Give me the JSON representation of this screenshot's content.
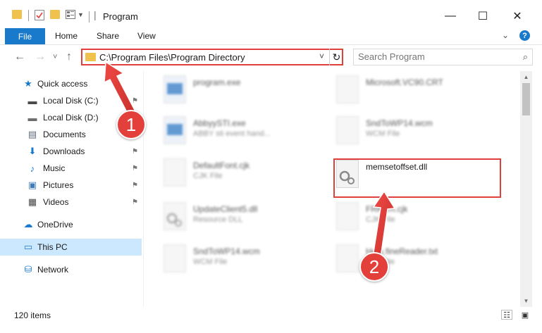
{
  "window": {
    "title": "Program",
    "controls": {
      "minimize": "—",
      "maximize": "☐",
      "close": "✕"
    }
  },
  "ribbon": {
    "tabs": [
      "File",
      "Home",
      "Share",
      "View"
    ],
    "collapse_icon": "chevron-down-icon",
    "help": "?"
  },
  "navigation": {
    "back": "←",
    "forward": "→",
    "recent": "˅",
    "up": "↑",
    "address": "C:\\Program Files\\Program Directory",
    "address_dropdown": "˅",
    "refresh": "↻",
    "search_placeholder": "Search Program",
    "search_icon": "⌕"
  },
  "sidebar": {
    "items": [
      {
        "label": "Quick access",
        "icon": "star-icon",
        "glyph": "★",
        "color": "#1979ca",
        "pinned": false
      },
      {
        "label": "Local Disk (C:)",
        "icon": "drive-icon",
        "glyph": "▬",
        "color": "#4a4a4a",
        "pinned": true
      },
      {
        "label": "Local Disk (D:)",
        "icon": "drive-icon",
        "glyph": "▬",
        "color": "#6d6d6d",
        "pinned": true
      },
      {
        "label": "Documents",
        "icon": "documents-icon",
        "glyph": "▤",
        "color": "#5a6a7a",
        "pinned": true
      },
      {
        "label": "Downloads",
        "icon": "downloads-icon",
        "glyph": "⬇",
        "color": "#1979ca",
        "pinned": true
      },
      {
        "label": "Music",
        "icon": "music-icon",
        "glyph": "♪",
        "color": "#1979ca",
        "pinned": true
      },
      {
        "label": "Pictures",
        "icon": "pictures-icon",
        "glyph": "▣",
        "color": "#3f7cb8",
        "pinned": true
      },
      {
        "label": "Videos",
        "icon": "videos-icon",
        "glyph": "▦",
        "color": "#444444",
        "pinned": true
      },
      {
        "label": "OneDrive",
        "icon": "cloud-icon",
        "glyph": "☁",
        "color": "#1979ca",
        "pinned": false
      },
      {
        "label": "This PC",
        "icon": "computer-icon",
        "glyph": "▭",
        "color": "#1979ca",
        "pinned": false
      },
      {
        "label": "Network",
        "icon": "network-icon",
        "glyph": "⛁",
        "color": "#1979ca",
        "pinned": false
      }
    ],
    "pin_glyph": "📌"
  },
  "files": [
    {
      "name": "program.exe",
      "type": "",
      "blurred": true
    },
    {
      "name": "Microsoft.VC90.CRT",
      "type": "",
      "blurred": true
    },
    {
      "name": "AbbyySTI.exe",
      "type": "ABBY sti event hand...",
      "blurred": true
    },
    {
      "name": "SndToWP14.wcm",
      "type": "WCM File",
      "blurred": true
    },
    {
      "name": "DefaultFont.cjk",
      "type": "CJK File",
      "blurred": true
    },
    {
      "name": "memsetoffset.dll",
      "type": "",
      "blurred": false
    },
    {
      "name": "UpdateClient5.dll",
      "type": "Resource DLL",
      "blurred": true
    },
    {
      "name": "FRKorn.cjk",
      "type": "CJK File",
      "blurred": true
    },
    {
      "name": "SndToWP14.wcm",
      "type": "WCM File",
      "blurred": true
    },
    {
      "name": "Help.fineReader.txt",
      "type": "Text File",
      "blurred": true
    }
  ],
  "status": {
    "item_count": "120 items"
  },
  "annotations": {
    "badge_1": "1",
    "badge_2": "2",
    "accent": "#e3403c"
  }
}
